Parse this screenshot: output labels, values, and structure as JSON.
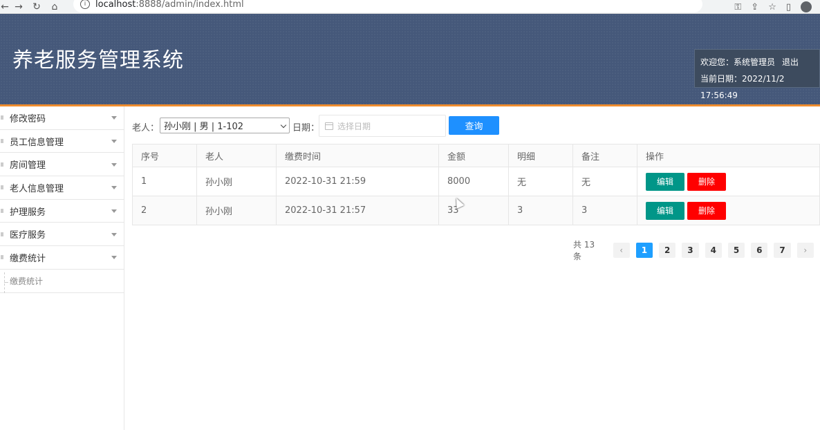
{
  "browser": {
    "url_host": "localhost",
    "url_path": ":8888/admin/index.html",
    "info_glyph": "i"
  },
  "header": {
    "title": "养老服务管理系统",
    "welcome": "欢迎您：系统管理员",
    "logout": "退出",
    "date_label": "当前日期：2022/11/2 17:56:49"
  },
  "sidebar": {
    "items": [
      {
        "label": "修改密码"
      },
      {
        "label": "员工信息管理"
      },
      {
        "label": "房间管理"
      },
      {
        "label": "老人信息管理"
      },
      {
        "label": "护理服务"
      },
      {
        "label": "医疗服务"
      },
      {
        "label": "缴费统计"
      }
    ],
    "sub_item": "缴费统计"
  },
  "search": {
    "elder_label": "老人：",
    "elder_value": "孙小刚 | 男 | 1-102",
    "date_label": "日期：",
    "date_placeholder": "选择日期",
    "query_label": "查询"
  },
  "table": {
    "headers": [
      "序号",
      "老人",
      "缴费时间",
      "金额",
      "明细",
      "备注",
      "操作"
    ],
    "rows": [
      {
        "no": "1",
        "elder": "孙小刚",
        "time": "2022-10-31 21:59",
        "amount": "8000",
        "detail": "无",
        "note": "无"
      },
      {
        "no": "2",
        "elder": "孙小刚",
        "time": "2022-10-31 21:57",
        "amount": "33",
        "detail": "3",
        "note": "3"
      }
    ],
    "edit_label": "编辑",
    "delete_label": "删除"
  },
  "pagination": {
    "total": "共 13 条",
    "prev": "‹",
    "next": "›",
    "pages": [
      "1",
      "2",
      "3",
      "4",
      "5",
      "6",
      "7"
    ],
    "current": "1"
  },
  "colors": {
    "header_bg": "#45587a",
    "accent_line": "#f08d2e",
    "primary": "#1e90ff",
    "edit": "#009688",
    "delete": "#ff0000"
  }
}
